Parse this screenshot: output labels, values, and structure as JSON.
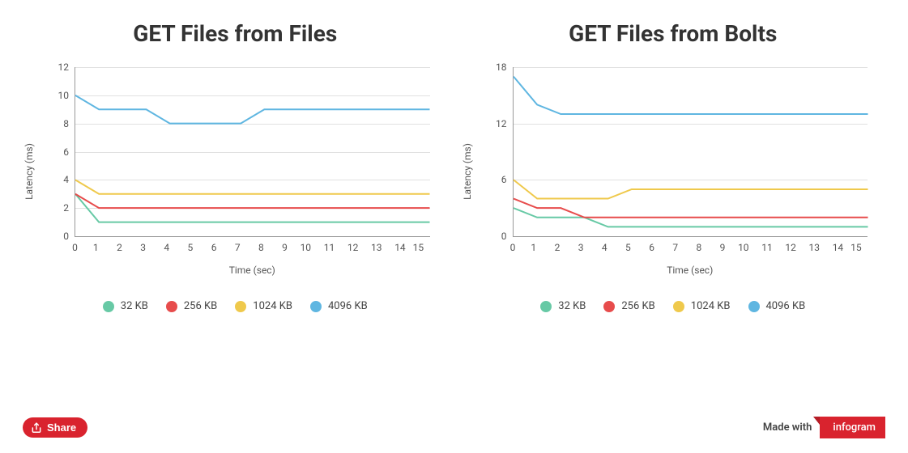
{
  "chart_data": [
    {
      "type": "line",
      "title": "GET Files from Files",
      "xlabel": "Time (sec)",
      "ylabel": "Latency (ms)",
      "x": [
        0,
        1,
        2,
        3,
        4,
        5,
        6,
        7,
        8,
        9,
        10,
        11,
        12,
        13,
        14,
        15
      ],
      "ylim": [
        0,
        12
      ],
      "yticks": [
        0,
        2,
        4,
        6,
        8,
        10,
        12
      ],
      "series": [
        {
          "name": "32 KB",
          "color": "#67c9a5",
          "values": [
            3.0,
            1.0,
            1.0,
            1.0,
            1.0,
            1.0,
            1.0,
            1.0,
            1.0,
            1.0,
            1.0,
            1.0,
            1.0,
            1.0,
            1.0,
            1.0
          ]
        },
        {
          "name": "256 KB",
          "color": "#e74c4c",
          "values": [
            3.0,
            2.0,
            2.0,
            2.0,
            2.0,
            2.0,
            2.0,
            2.0,
            2.0,
            2.0,
            2.0,
            2.0,
            2.0,
            2.0,
            2.0,
            2.0
          ]
        },
        {
          "name": "1024 KB",
          "color": "#efc94c",
          "values": [
            4.0,
            3.0,
            3.0,
            3.0,
            3.0,
            3.0,
            3.0,
            3.0,
            3.0,
            3.0,
            3.0,
            3.0,
            3.0,
            3.0,
            3.0,
            3.0
          ]
        },
        {
          "name": "4096 KB",
          "color": "#5fb6e1",
          "values": [
            10.0,
            9.0,
            9.0,
            9.0,
            8.0,
            8.0,
            8.0,
            8.0,
            9.0,
            9.0,
            9.0,
            9.0,
            9.0,
            9.0,
            9.0,
            9.0
          ]
        }
      ]
    },
    {
      "type": "line",
      "title": "GET Files from Bolts",
      "xlabel": "Time (sec)",
      "ylabel": "Latency (ms)",
      "x": [
        0,
        1,
        2,
        3,
        4,
        5,
        6,
        7,
        8,
        9,
        10,
        11,
        12,
        13,
        14,
        15
      ],
      "ylim": [
        0,
        18
      ],
      "yticks": [
        0,
        6,
        12,
        18
      ],
      "series": [
        {
          "name": "32 KB",
          "color": "#67c9a5",
          "values": [
            3.0,
            2.0,
            2.0,
            2.0,
            1.0,
            1.0,
            1.0,
            1.0,
            1.0,
            1.0,
            1.0,
            1.0,
            1.0,
            1.0,
            1.0,
            1.0
          ]
        },
        {
          "name": "256 KB",
          "color": "#e74c4c",
          "values": [
            4.0,
            3.0,
            3.0,
            2.0,
            2.0,
            2.0,
            2.0,
            2.0,
            2.0,
            2.0,
            2.0,
            2.0,
            2.0,
            2.0,
            2.0,
            2.0
          ]
        },
        {
          "name": "1024 KB",
          "color": "#efc94c",
          "values": [
            6.0,
            4.0,
            4.0,
            4.0,
            4.0,
            5.0,
            5.0,
            5.0,
            5.0,
            5.0,
            5.0,
            5.0,
            5.0,
            5.0,
            5.0,
            5.0
          ]
        },
        {
          "name": "4096 KB",
          "color": "#5fb6e1",
          "values": [
            17.0,
            14.0,
            13.0,
            13.0,
            13.0,
            13.0,
            13.0,
            13.0,
            13.0,
            13.0,
            13.0,
            13.0,
            13.0,
            13.0,
            13.0,
            13.0
          ]
        }
      ]
    }
  ],
  "footer": {
    "share_label": "Share",
    "made_with_label": "Made with",
    "brand": "infogram"
  }
}
